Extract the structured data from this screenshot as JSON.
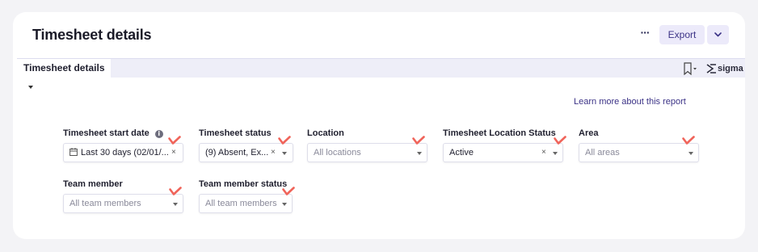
{
  "header": {
    "title": "Timesheet details",
    "more_label": "···",
    "export_label": "Export"
  },
  "tabbar": {
    "active_tab": "Timesheet details",
    "brand": "sigma"
  },
  "learn_more": "Learn more about this report",
  "filters": {
    "start_date": {
      "label": "Timesheet start date",
      "info": "i",
      "value": "Last 30 days (02/01/...",
      "clear": "×"
    },
    "status": {
      "label": "Timesheet status",
      "value": "(9) Absent, Ex...",
      "clear": "×"
    },
    "location": {
      "label": "Location",
      "placeholder": "All locations"
    },
    "location_status": {
      "label": "Timesheet Location Status",
      "value": "Active",
      "clear": "×"
    },
    "area": {
      "label": "Area",
      "placeholder": "All areas"
    },
    "team_member": {
      "label": "Team member",
      "placeholder": "All team members"
    },
    "team_member_status": {
      "label": "Team member status",
      "placeholder": "All team members"
    }
  },
  "colors": {
    "accent": "#3b3286",
    "check_mark": "#f0645a",
    "tab_bg": "#eeeef8",
    "button_bg": "#eceafa"
  }
}
